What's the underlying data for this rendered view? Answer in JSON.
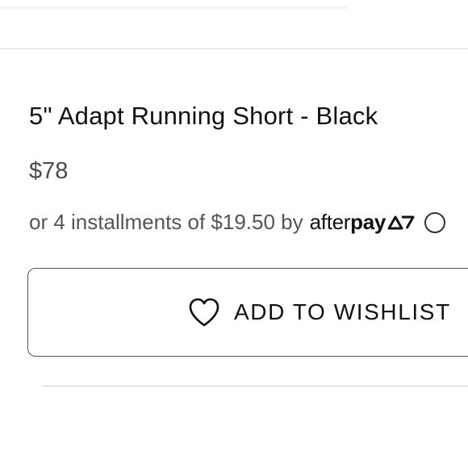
{
  "product": {
    "title": "5\" Adapt Running Short - Black",
    "price": "$78"
  },
  "installments": {
    "text": "or 4 installments of $19.50 by",
    "provider_logo": {
      "after": "after",
      "pay": "pay",
      "mark_icon": "afterpay-arrows-icon"
    },
    "info_icon": "info-icon"
  },
  "wishlist": {
    "label": "ADD TO WISHLIST",
    "icon": "heart-icon"
  },
  "colors": {
    "text_primary": "#111111",
    "text_secondary": "#555555",
    "price": "#4a4a4a",
    "button_border": "#555555",
    "divider": "#dcdcdc"
  }
}
